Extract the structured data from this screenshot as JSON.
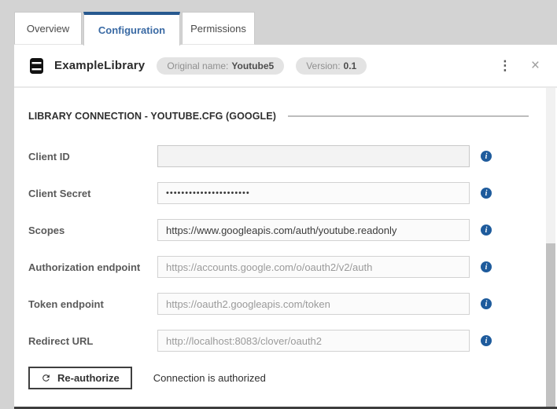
{
  "tabs": [
    {
      "label": "Overview",
      "active": false
    },
    {
      "label": "Configuration",
      "active": true
    },
    {
      "label": "Permissions",
      "active": false
    }
  ],
  "header": {
    "title": "ExampleLibrary",
    "badges": [
      {
        "label": "Original name:",
        "value": "Youtube5"
      },
      {
        "label": "Version:",
        "value": "0.1"
      }
    ],
    "kebab_icon": "⋮",
    "close_icon": "×"
  },
  "section_title": "LIBRARY CONNECTION - YOUTUBE.CFG (GOOGLE)",
  "form": {
    "fields": [
      {
        "label": "Client ID",
        "value": "",
        "placeholder": "",
        "info_icon": "i"
      },
      {
        "label": "Client Secret",
        "value": "••••••••••••••••••••••",
        "placeholder": "",
        "info_icon": "i"
      },
      {
        "label": "Scopes",
        "value": "https://www.googleapis.com/auth/youtube.readonly",
        "placeholder": "",
        "info_icon": "i"
      },
      {
        "label": "Authorization endpoint",
        "value": "",
        "placeholder": "https://accounts.google.com/o/oauth2/v2/auth",
        "info_icon": "i"
      },
      {
        "label": "Token endpoint",
        "value": "",
        "placeholder": "https://oauth2.googleapis.com/token",
        "info_icon": "i"
      },
      {
        "label": "Redirect URL",
        "value": "",
        "placeholder": "http://localhost:8083/clover/oauth2",
        "info_icon": "i"
      }
    ]
  },
  "footer": {
    "reauthorize_label": "Re-authorize",
    "status_text": "Connection is authorized"
  },
  "colors": {
    "accent_blue": "#27598f",
    "active_tab_text": "#3a6aa4",
    "info_icon_bg": "#1e5b9c",
    "badge_bg": "#e3e3e3",
    "panel_bg": "#ffffff",
    "window_bg": "#d3d3d3"
  }
}
